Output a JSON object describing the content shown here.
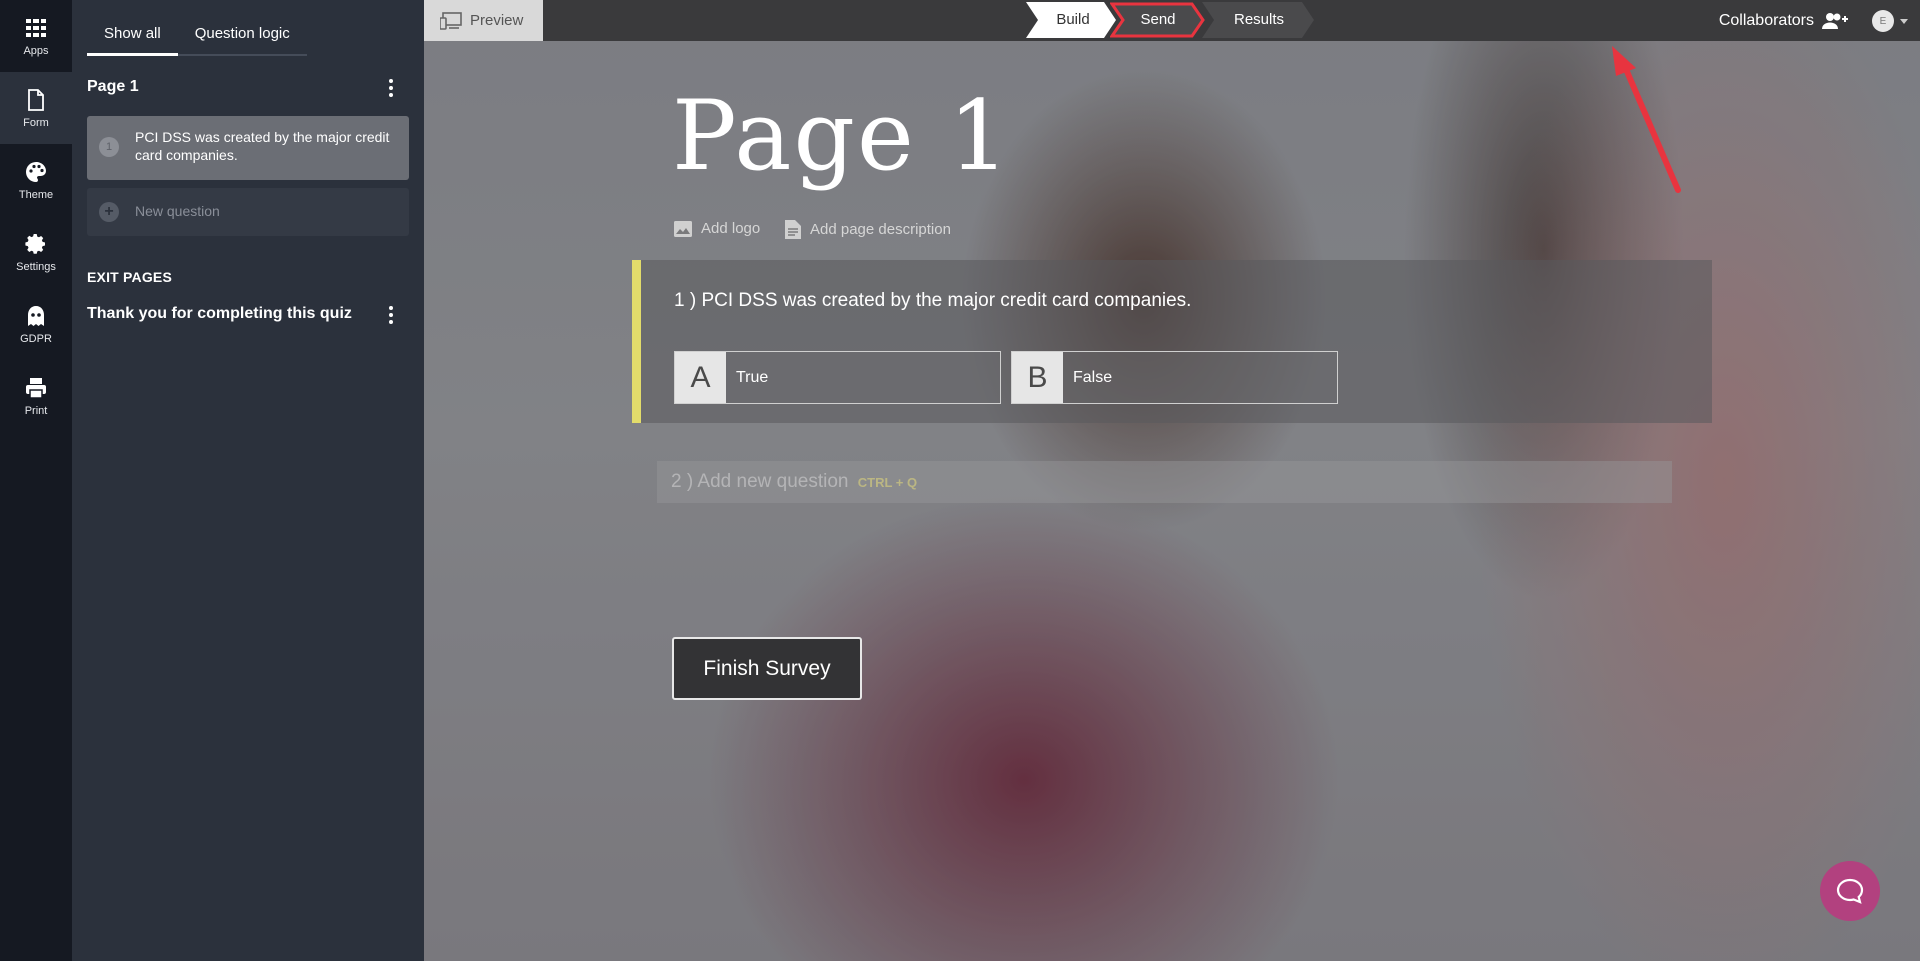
{
  "rail": {
    "items": [
      {
        "label": "Apps",
        "icon": "grid-icon"
      },
      {
        "label": "Form",
        "icon": "document-icon"
      },
      {
        "label": "Theme",
        "icon": "palette-icon"
      },
      {
        "label": "Settings",
        "icon": "gear-icon"
      },
      {
        "label": "GDPR",
        "icon": "ghost-icon"
      },
      {
        "label": "Print",
        "icon": "printer-icon"
      }
    ],
    "active": "Form"
  },
  "sidebar": {
    "tabs": [
      "Show all",
      "Question logic"
    ],
    "active_tab": "Show all",
    "page_title": "Page 1",
    "questions": [
      {
        "number": "1",
        "text": "PCI DSS was created by the major credit card companies."
      }
    ],
    "new_question": "New question",
    "exit_pages_label": "EXIT PAGES",
    "exit_page_title": "Thank you for completing this quiz"
  },
  "topbar": {
    "preview": "Preview",
    "steps": [
      "Build",
      "Send",
      "Results"
    ],
    "active_step": "Build",
    "highlighted_step": "Send",
    "collaborators": "Collaborators",
    "avatar_initial": "E"
  },
  "form": {
    "page_title": "Page 1",
    "add_logo": "Add logo",
    "add_page_description": "Add page description",
    "question": {
      "number": "1 )",
      "text": "PCI DSS was created by the major credit card companies.",
      "choices": [
        {
          "key": "A",
          "text": "True"
        },
        {
          "key": "B",
          "text": "False"
        }
      ]
    },
    "add_question": {
      "number": "2 )",
      "text": "Add new question",
      "shortcut": "CTRL + Q"
    },
    "finish_button": "Finish Survey"
  },
  "colors": {
    "accent_yellow": "#e2dc6b",
    "highlight_red": "#e8343f",
    "chat_bubble": "#b2417f",
    "rail_bg": "#151922",
    "panel_bg": "#2b313c"
  }
}
